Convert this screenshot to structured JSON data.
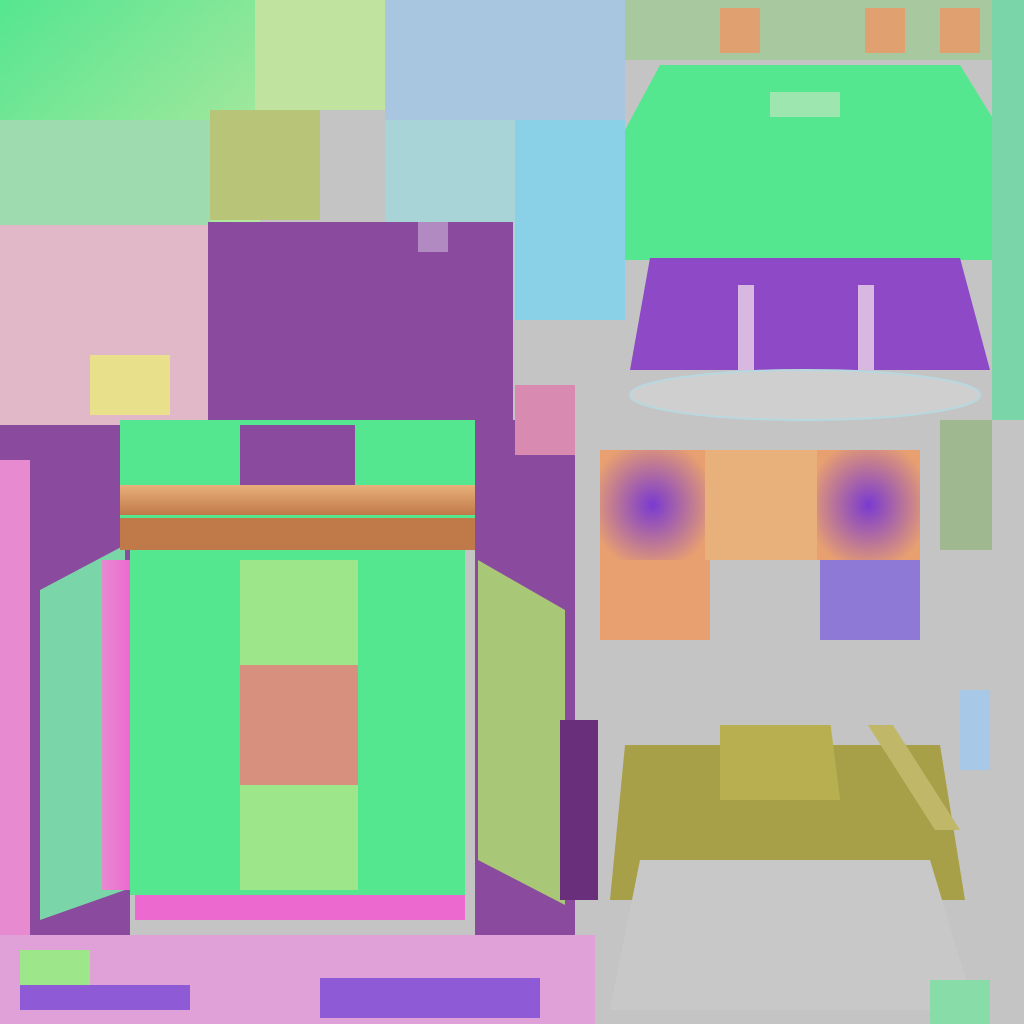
{
  "image": {
    "kind": "texture-atlas",
    "visible_text": []
  },
  "palette": {
    "mint_green": "#55e690",
    "light_green": "#9ee68a",
    "purple": "#8a4a9e",
    "deep_purple": "#6a2f7a",
    "violet": "#8e5ad6",
    "pink": "#e88ad0",
    "hot_pink": "#ec6ad0",
    "salmon": "#d8907e",
    "peach": "#e8b07a",
    "orange_brown": "#c07a4a",
    "sky_blue": "#a8c6e0",
    "light_blue": "#8ad0e6",
    "olive": "#a8a048",
    "tan": "#d8c8a0",
    "neutral_gray": "#c4c4c4"
  },
  "regions": [
    {
      "name": "top-left-green-cloud-patch"
    },
    {
      "name": "upper-sky-blue-patch"
    },
    {
      "name": "left-pink-patch"
    },
    {
      "name": "purple-block"
    },
    {
      "name": "central-green-box-front"
    },
    {
      "name": "salmon-square"
    },
    {
      "name": "left-purple-side-panel"
    },
    {
      "name": "right-purple-side-panel"
    },
    {
      "name": "bottom-pink-strip"
    },
    {
      "name": "right-green-roof"
    },
    {
      "name": "right-purple-band"
    },
    {
      "name": "gray-ellipse"
    },
    {
      "name": "gradient-orange-violet-squares"
    },
    {
      "name": "olive-diagonal-panel"
    },
    {
      "name": "gray-lower-right-area"
    }
  ]
}
